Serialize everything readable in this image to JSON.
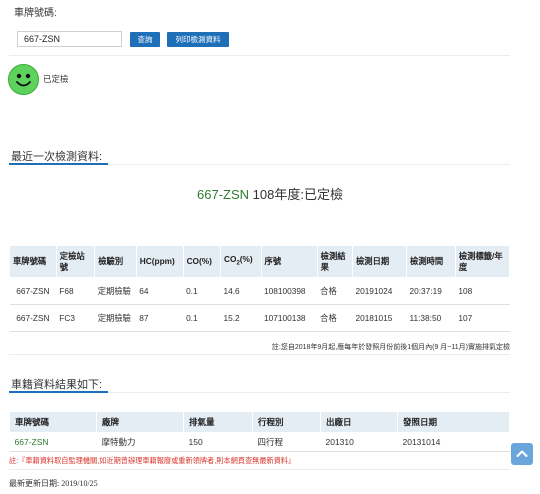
{
  "search": {
    "label": "車牌號碼:",
    "value": "667-ZSN",
    "query_button": "查詢",
    "print_button": "列印檢測資料"
  },
  "status": {
    "icon": "smiley-icon",
    "text": "已定檢",
    "color": "#5dd35d"
  },
  "latest": {
    "section_title": "最近一次檢測資料:",
    "headline_plate": "667-ZSN",
    "headline_rest": " 108年度:已定檢",
    "headers": [
      "車牌號碼",
      "定檢站號",
      "檢驗別",
      "HC(ppm)",
      "CO(%)",
      "CO2(%)",
      "序號",
      "檢測結果",
      "檢測日期",
      "檢測時間",
      "檢測標籤/年度"
    ],
    "co2_main": "CO",
    "co2_sub": "2",
    "co2_tail": "(%)",
    "rows": [
      [
        "667-ZSN",
        "F68",
        "定期檢驗",
        "64",
        "0.1",
        "14.6",
        "108100398",
        "合格",
        "20191024",
        "20:37:19",
        "108"
      ],
      [
        "667-ZSN",
        "FC3",
        "定期檢驗",
        "87",
        "0.1",
        "15.2",
        "107100138",
        "合格",
        "20181015",
        "11:38:50",
        "107"
      ]
    ],
    "note": "註:您自2018年9月起,應每年於發照月份前後1個月內(9 月~11月)實施排氣定檢"
  },
  "registry": {
    "section_title": "車籍資料結果如下:",
    "headers": [
      "車牌號碼",
      "廠牌",
      "排氣量",
      "行程別",
      "出廠日",
      "發照日期"
    ],
    "row": [
      "667-ZSN",
      "摩特動力",
      "150",
      "四行程",
      "201310",
      "20131014"
    ],
    "note": "註:『車籍資料取自監理機關,如近期曾辦理車籍報廢或重新領牌者,則本網頁查無最新資料』"
  },
  "updated": "最新更新日期: 2019/10/25",
  "colors": {
    "accent": "#1f6fb8",
    "header_bg": "#e4ecf4",
    "plate_green": "#2f7a2f",
    "note_red": "#d9342b"
  }
}
